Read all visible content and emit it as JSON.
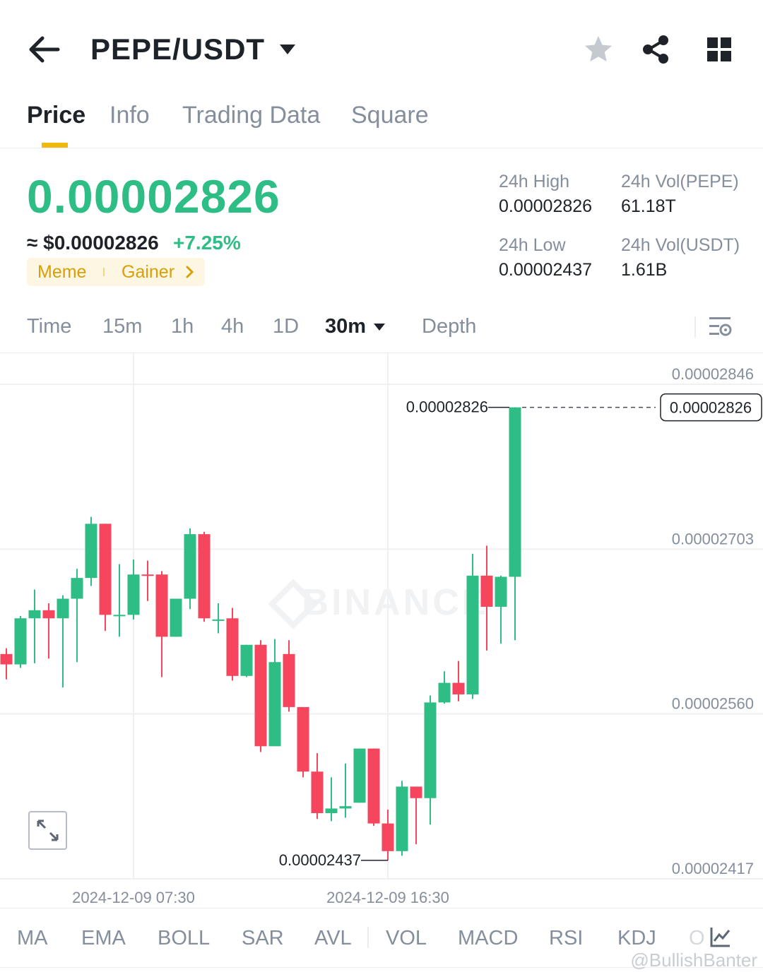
{
  "header": {
    "pair": "PEPE/USDT"
  },
  "tabs": [
    "Price",
    "Info",
    "Trading Data",
    "Square"
  ],
  "price": {
    "last": "0.00002826",
    "fiat": "≈ $0.00002826",
    "change": "+7.25%",
    "tags": [
      "Meme",
      "Gainer"
    ]
  },
  "stats": {
    "high_label": "24h High",
    "high_value": "0.00002826",
    "low_label": "24h Low",
    "low_value": "0.00002437",
    "vol_base_label": "24h Vol(PEPE)",
    "vol_base_value": "61.18T",
    "vol_quote_label": "24h Vol(USDT)",
    "vol_quote_value": "1.61B"
  },
  "intervals": {
    "items": [
      "Time",
      "15m",
      "1h",
      "4h",
      "1D"
    ],
    "selected": "30m",
    "depth": "Depth"
  },
  "chart_data": {
    "type": "candlestick",
    "y_ticks": [
      "0.00002846",
      "0.00002703",
      "0.00002560",
      "0.00002417"
    ],
    "y_min": 2.417e-05,
    "y_max": 2.846e-05,
    "x_ticks": [
      "2024-12-09 07:30",
      "2024-12-09 16:30"
    ],
    "high_marker": "0.00002826",
    "low_marker": "0.00002437",
    "last_price_label": "0.00002826",
    "watermark": "BINANCE",
    "candles": [
      {
        "o": 2.612e-05,
        "h": 2.617e-05,
        "l": 2.59e-05,
        "c": 2.603e-05
      },
      {
        "o": 2.603e-05,
        "h": 2.645e-05,
        "l": 2.6e-05,
        "c": 2.643e-05
      },
      {
        "o": 2.643e-05,
        "h": 2.668e-05,
        "l": 2.604e-05,
        "c": 2.65e-05
      },
      {
        "o": 2.65e-05,
        "h": 2.656e-05,
        "l": 2.608e-05,
        "c": 2.643e-05
      },
      {
        "o": 2.643e-05,
        "h": 2.663e-05,
        "l": 2.583e-05,
        "c": 2.66e-05
      },
      {
        "o": 2.66e-05,
        "h": 2.686e-05,
        "l": 2.605e-05,
        "c": 2.678e-05
      },
      {
        "o": 2.678e-05,
        "h": 2.731e-05,
        "l": 2.671e-05,
        "c": 2.725e-05
      },
      {
        "o": 2.725e-05,
        "h": 2.725e-05,
        "l": 2.632e-05,
        "c": 2.646e-05
      },
      {
        "o": 2.646e-05,
        "h": 2.69e-05,
        "l": 2.627e-05,
        "c": 2.646e-05
      },
      {
        "o": 2.646e-05,
        "h": 2.694e-05,
        "l": 2.642e-05,
        "c": 2.681e-05
      },
      {
        "o": 2.681e-05,
        "h": 2.693e-05,
        "l": 2.658e-05,
        "c": 2.68e-05
      },
      {
        "o": 2.681e-05,
        "h": 2.684e-05,
        "l": 2.592e-05,
        "c": 2.627e-05
      },
      {
        "o": 2.627e-05,
        "h": 2.66e-05,
        "l": 2.627e-05,
        "c": 2.66e-05
      },
      {
        "o": 2.66e-05,
        "h": 2.721e-05,
        "l": 2.651e-05,
        "c": 2.716e-05
      },
      {
        "o": 2.716e-05,
        "h": 2.718e-05,
        "l": 2.64e-05,
        "c": 2.643e-05
      },
      {
        "o": 2.642e-05,
        "h": 2.656e-05,
        "l": 2.63e-05,
        "c": 2.642e-05
      },
      {
        "o": 2.643e-05,
        "h": 2.652e-05,
        "l": 2.589e-05,
        "c": 2.593e-05
      },
      {
        "o": 2.593e-05,
        "h": 2.62e-05,
        "l": 2.592e-05,
        "c": 2.62e-05
      },
      {
        "o": 2.62e-05,
        "h": 2.624e-05,
        "l": 2.527e-05,
        "c": 2.532e-05
      },
      {
        "o": 2.532e-05,
        "h": 2.625e-05,
        "l": 2.537e-05,
        "c": 2.605e-05
      },
      {
        "o": 2.612e-05,
        "h": 2.624e-05,
        "l": 2.562e-05,
        "c": 2.566e-05
      },
      {
        "o": 2.566e-05,
        "h": 2.566e-05,
        "l": 2.505e-05,
        "c": 2.51e-05
      },
      {
        "o": 2.51e-05,
        "h": 2.526e-05,
        "l": 2.469e-05,
        "c": 2.474e-05
      },
      {
        "o": 2.474e-05,
        "h": 2.505e-05,
        "l": 2.467e-05,
        "c": 2.478e-05
      },
      {
        "o": 2.478e-05,
        "h": 2.517e-05,
        "l": 2.47e-05,
        "c": 2.48e-05
      },
      {
        "o": 2.483e-05,
        "h": 2.53e-05,
        "l": 2.483e-05,
        "c": 2.53e-05
      },
      {
        "o": 2.53e-05,
        "h": 2.53e-05,
        "l": 2.463e-05,
        "c": 2.465e-05
      },
      {
        "o": 2.465e-05,
        "h": 2.477e-05,
        "l": 2.433e-05,
        "c": 2.441e-05
      },
      {
        "o": 2.441e-05,
        "h": 2.502e-05,
        "l": 2.437e-05,
        "c": 2.497e-05
      },
      {
        "o": 2.497e-05,
        "h": 2.497e-05,
        "l": 2.447e-05,
        "c": 2.487e-05
      },
      {
        "o": 2.487e-05,
        "h": 2.576e-05,
        "l": 2.464e-05,
        "c": 2.57e-05
      },
      {
        "o": 2.57e-05,
        "h": 2.597e-05,
        "l": 2.569e-05,
        "c": 2.587e-05
      },
      {
        "o": 2.587e-05,
        "h": 2.606e-05,
        "l": 2.571e-05,
        "c": 2.577e-05
      },
      {
        "o": 2.577e-05,
        "h": 2.699e-05,
        "l": 2.573e-05,
        "c": 2.68e-05
      },
      {
        "o": 2.68e-05,
        "h": 2.706e-05,
        "l": 2.615e-05,
        "c": 2.653e-05
      },
      {
        "o": 2.653e-05,
        "h": 2.68e-05,
        "l": 2.621e-05,
        "c": 2.679e-05
      },
      {
        "o": 2.679e-05,
        "h": 2.826e-05,
        "l": 2.624e-05,
        "c": 2.826e-05
      }
    ]
  },
  "indicators": [
    "MA",
    "EMA",
    "BOLL",
    "SAR",
    "AVL",
    "VOL",
    "MACD",
    "RSI",
    "KDJ",
    "O"
  ],
  "watermark_handle": "@BullishBanter",
  "colors": {
    "up": "#2ebd85",
    "down": "#f6465d",
    "accent": "#f0b90b"
  }
}
